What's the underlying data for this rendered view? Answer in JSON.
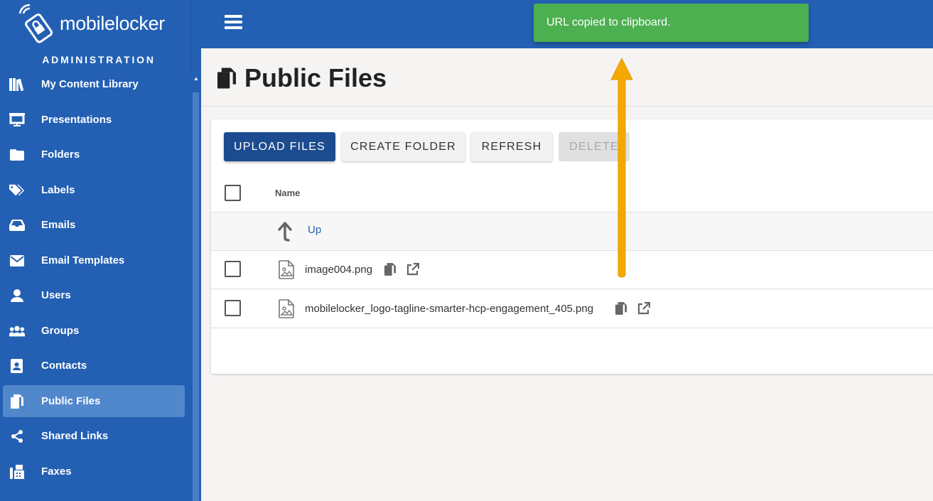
{
  "brand": {
    "logo_text_part1": "mobile",
    "logo_text_part2": "locker"
  },
  "sidebar": {
    "section_label": "ADMINISTRATION",
    "items": [
      {
        "label": "My Content Library",
        "icon": "library-icon"
      },
      {
        "label": "Presentations",
        "icon": "presentation-icon"
      },
      {
        "label": "Folders",
        "icon": "folder-icon"
      },
      {
        "label": "Labels",
        "icon": "tags-icon"
      },
      {
        "label": "Emails",
        "icon": "inbox-icon"
      },
      {
        "label": "Email Templates",
        "icon": "envelope-icon"
      },
      {
        "label": "Users",
        "icon": "user-icon"
      },
      {
        "label": "Groups",
        "icon": "users-icon"
      },
      {
        "label": "Contacts",
        "icon": "address-book-icon"
      },
      {
        "label": "Public Files",
        "icon": "copy-icon",
        "active": true
      },
      {
        "label": "Shared Links",
        "icon": "share-icon"
      },
      {
        "label": "Faxes",
        "icon": "fax-icon"
      }
    ]
  },
  "toast": {
    "message": "URL copied to clipboard."
  },
  "page": {
    "title": "Public Files"
  },
  "toolbar": {
    "upload_label": "UPLOAD FILES",
    "create_folder_label": "CREATE FOLDER",
    "refresh_label": "REFRESH",
    "delete_label": "DELETE"
  },
  "table": {
    "column_name": "Name",
    "up_label": "Up",
    "files": [
      {
        "name": "image004.png"
      },
      {
        "name": "mobilelocker_logo-tagline-smarter-hcp-engagement_405.png"
      }
    ]
  },
  "colors": {
    "primary": "#2360b3",
    "toast": "#4caf50",
    "annotation": "#f5a800"
  }
}
